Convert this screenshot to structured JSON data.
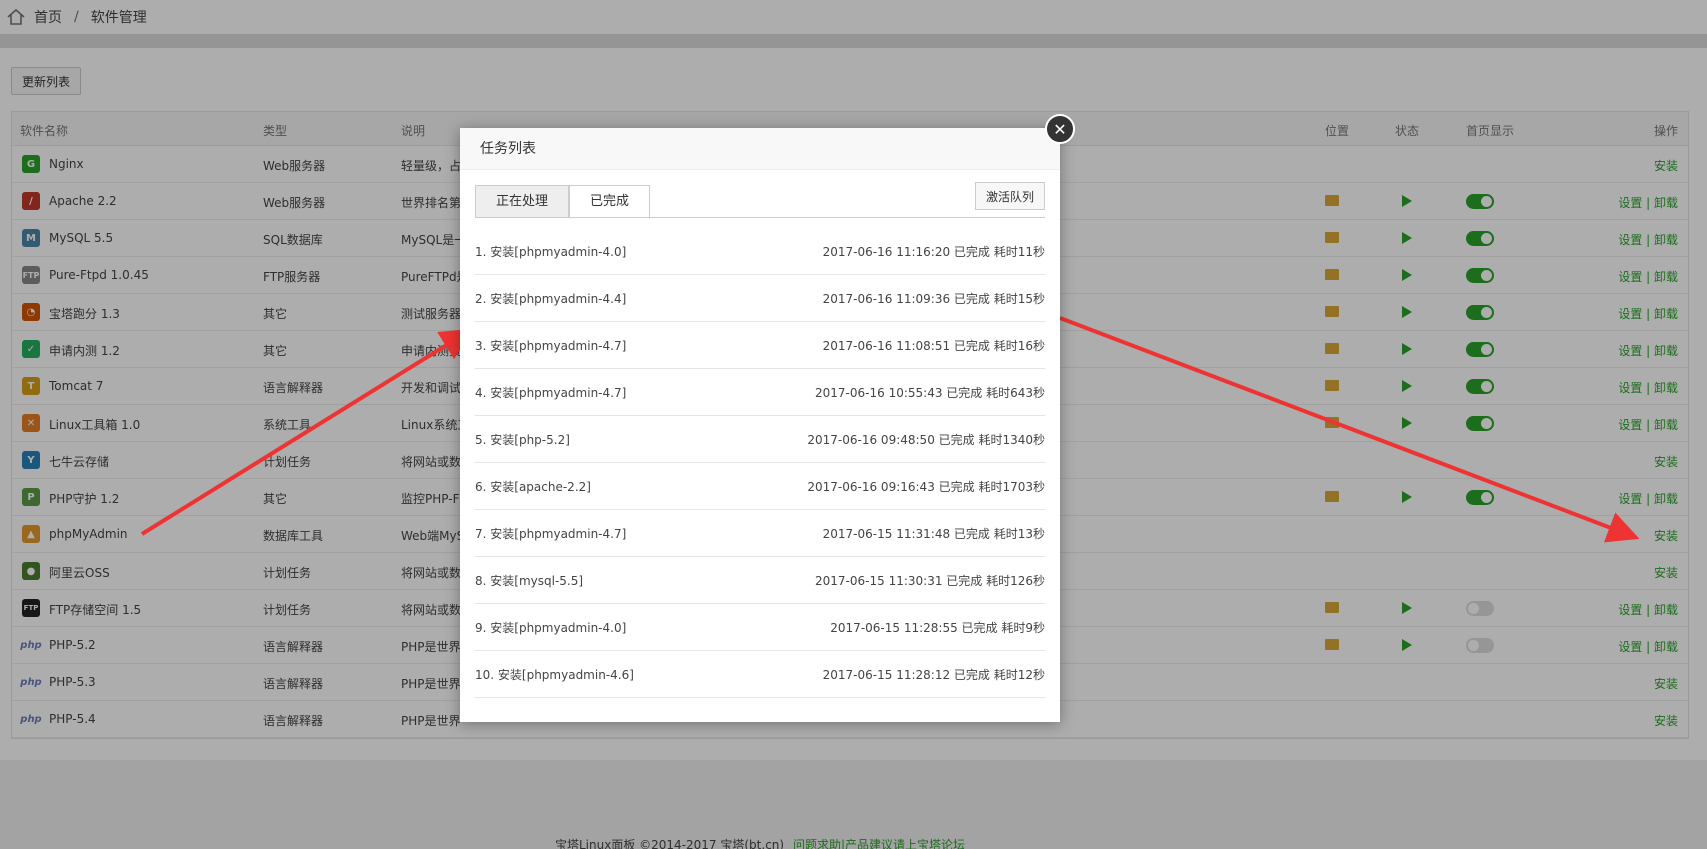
{
  "breadcrumb": {
    "home": "首页",
    "separator": "/",
    "current": "软件管理"
  },
  "toolbar": {
    "refresh_label": "更新列表"
  },
  "table": {
    "headers": {
      "name": "软件名称",
      "type": "类型",
      "desc": "说明",
      "location": "位置",
      "status": "状态",
      "homepage": "首页显示",
      "ops": "操作"
    },
    "rows": [
      {
        "name": "Nginx",
        "type": "Web服务器",
        "desc": "轻量级，占",
        "ops": "安装"
      },
      {
        "name": "Apache 2.2",
        "type": "Web服务器",
        "desc": "世界排名第",
        "ops": "设置 | 卸载"
      },
      {
        "name": "MySQL 5.5",
        "type": "SQL数据库",
        "desc": "MySQL是一",
        "ops": "设置 | 卸载"
      },
      {
        "name": "Pure-Ftpd 1.0.45",
        "type": "FTP服务器",
        "desc": "PureFTPd是",
        "ops": "设置 | 卸载"
      },
      {
        "name": "宝塔跑分 1.3",
        "type": "其它",
        "desc": "测试服务器",
        "ops": "设置 | 卸载"
      },
      {
        "name": "申请内测 1.2",
        "type": "其它",
        "desc": "申请内测资",
        "ops": "设置 | 卸载"
      },
      {
        "name": "Tomcat 7",
        "type": "语言解释器",
        "desc": "开发和调试",
        "ops": "设置 | 卸载"
      },
      {
        "name": "Linux工具箱 1.0",
        "type": "系统工具",
        "desc": "Linux系统工",
        "ops": "设置 | 卸载"
      },
      {
        "name": "七牛云存储",
        "type": "计划任务",
        "desc": "将网站或数",
        "ops": "安装"
      },
      {
        "name": "PHP守护 1.2",
        "type": "其它",
        "desc": "监控PHP-F",
        "ops": "设置 | 卸载"
      },
      {
        "name": "phpMyAdmin",
        "type": "数据库工具",
        "desc": "Web端MyS",
        "ops": "安装"
      },
      {
        "name": "阿里云OSS",
        "type": "计划任务",
        "desc": "将网站或数",
        "ops": "安装"
      },
      {
        "name": "FTP存储空间 1.5",
        "type": "计划任务",
        "desc": "将网站或数",
        "ops": "设置 | 卸载"
      },
      {
        "name": "PHP-5.2",
        "type": "语言解释器",
        "desc": "PHP是世界",
        "ops": "设置 | 卸载"
      },
      {
        "name": "PHP-5.3",
        "type": "语言解释器",
        "desc": "PHP是世界",
        "ops": "安装"
      },
      {
        "name": "PHP-5.4",
        "type": "语言解释器",
        "desc": "PHP是世界",
        "ops": "安装"
      }
    ]
  },
  "icons": [
    "home-icon",
    "nginx-icon",
    "apache-icon",
    "mysql-icon",
    "ftp-icon",
    "benchmark-icon",
    "beta-icon",
    "tomcat-icon",
    "toolbox-icon",
    "qiniu-icon",
    "shield-icon",
    "phpmyadmin-icon",
    "aliyun-icon",
    "ftp-cloud-icon",
    "php-icon",
    "folder-icon",
    "play-icon",
    "close-icon"
  ],
  "colors": {
    "accent_green": "#2aa12a",
    "folder": "#d9a83a",
    "arrow": "#ee3333"
  },
  "modal": {
    "title": "任务列表",
    "tabs": [
      "正在处理",
      "已完成"
    ],
    "queue_button": "激活队列",
    "close_symbol": "✕",
    "tasks": [
      {
        "label": "1. 安装[phpmyadmin-4.0]",
        "status": "2017-06-16 11:16:20 已完成 耗时11秒"
      },
      {
        "label": "2. 安装[phpmyadmin-4.4]",
        "status": "2017-06-16 11:09:36 已完成 耗时15秒"
      },
      {
        "label": "3. 安装[phpmyadmin-4.7]",
        "status": "2017-06-16 11:08:51 已完成 耗时16秒"
      },
      {
        "label": "4. 安装[phpmyadmin-4.7]",
        "status": "2017-06-16 10:55:43 已完成 耗时643秒"
      },
      {
        "label": "5. 安装[php-5.2]",
        "status": "2017-06-16 09:48:50 已完成 耗时1340秒"
      },
      {
        "label": "6. 安装[apache-2.2]",
        "status": "2017-06-16 09:16:43 已完成 耗时1703秒"
      },
      {
        "label": "7. 安装[phpmyadmin-4.7]",
        "status": "2017-06-15 11:31:48 已完成 耗时13秒"
      },
      {
        "label": "8. 安装[mysql-5.5]",
        "status": "2017-06-15 11:30:31 已完成 耗时126秒"
      },
      {
        "label": "9. 安装[phpmyadmin-4.0]",
        "status": "2017-06-15 11:28:55 已完成 耗时9秒"
      },
      {
        "label": "10. 安装[phpmyadmin-4.6]",
        "status": "2017-06-15 11:28:12 已完成 耗时12秒"
      }
    ]
  },
  "footer": {
    "copyright": "宝塔Linux面板 ©2014-2017 宝塔(bt.cn)",
    "link": "问题求助|产品建议请上宝塔论坛"
  }
}
